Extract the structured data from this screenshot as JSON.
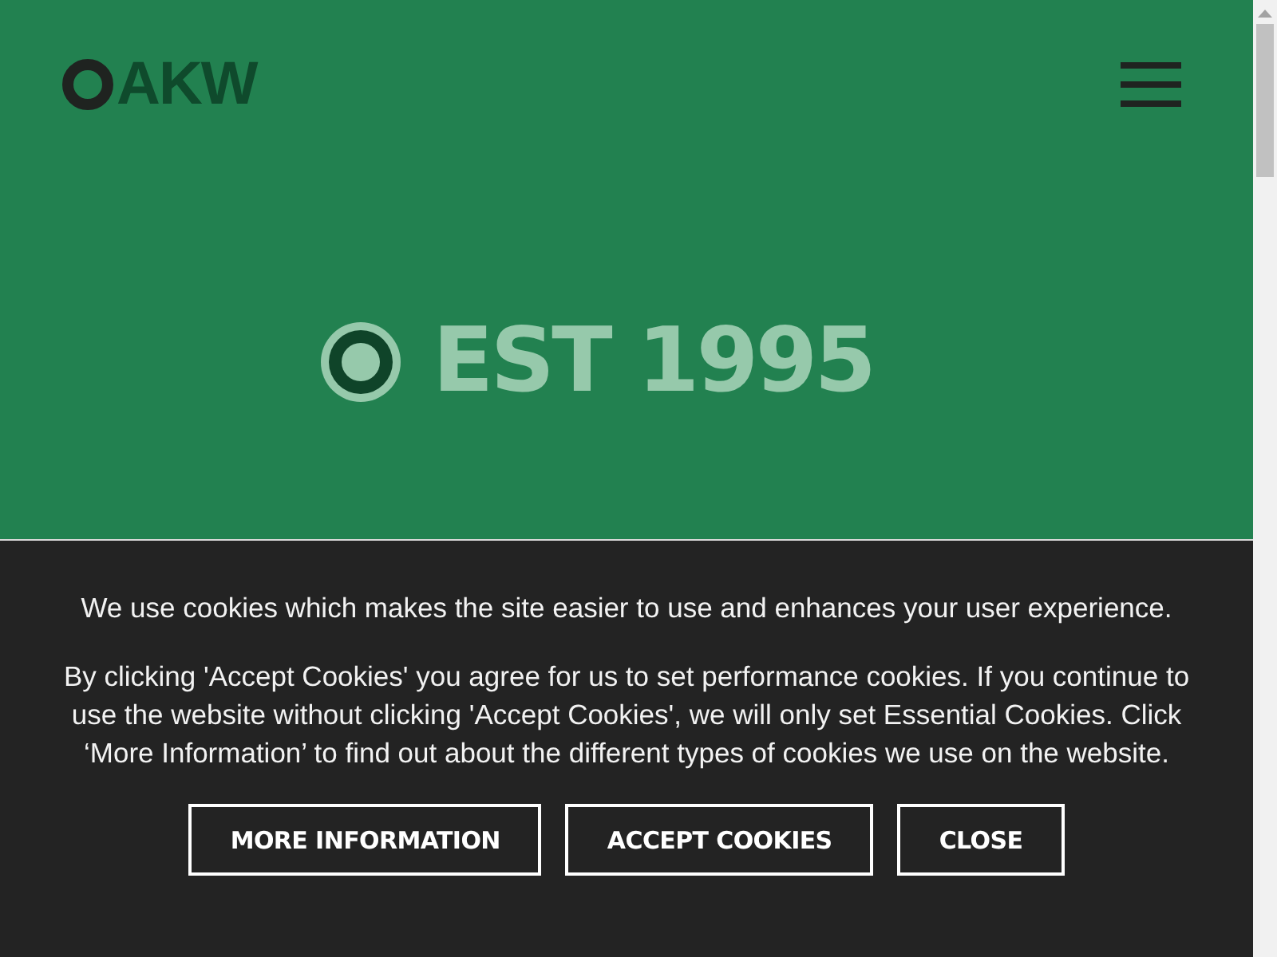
{
  "header": {
    "logo": "AKW"
  },
  "hero": {
    "tagline": "EST 1995"
  },
  "cookie_banner": {
    "intro": "We use cookies which makes the site easier to use and enhances your user experience.",
    "details": "By clicking 'Accept Cookies' you agree for us to set performance cookies. If you continue to use the website without clicking 'Accept Cookies', we will only set Essential Cookies. Click ‘More Information’ to find out about the different types of cookies we use on the website.",
    "buttons": [
      "MORE INFORMATION",
      "ACCEPT COOKIES",
      "CLOSE"
    ]
  }
}
